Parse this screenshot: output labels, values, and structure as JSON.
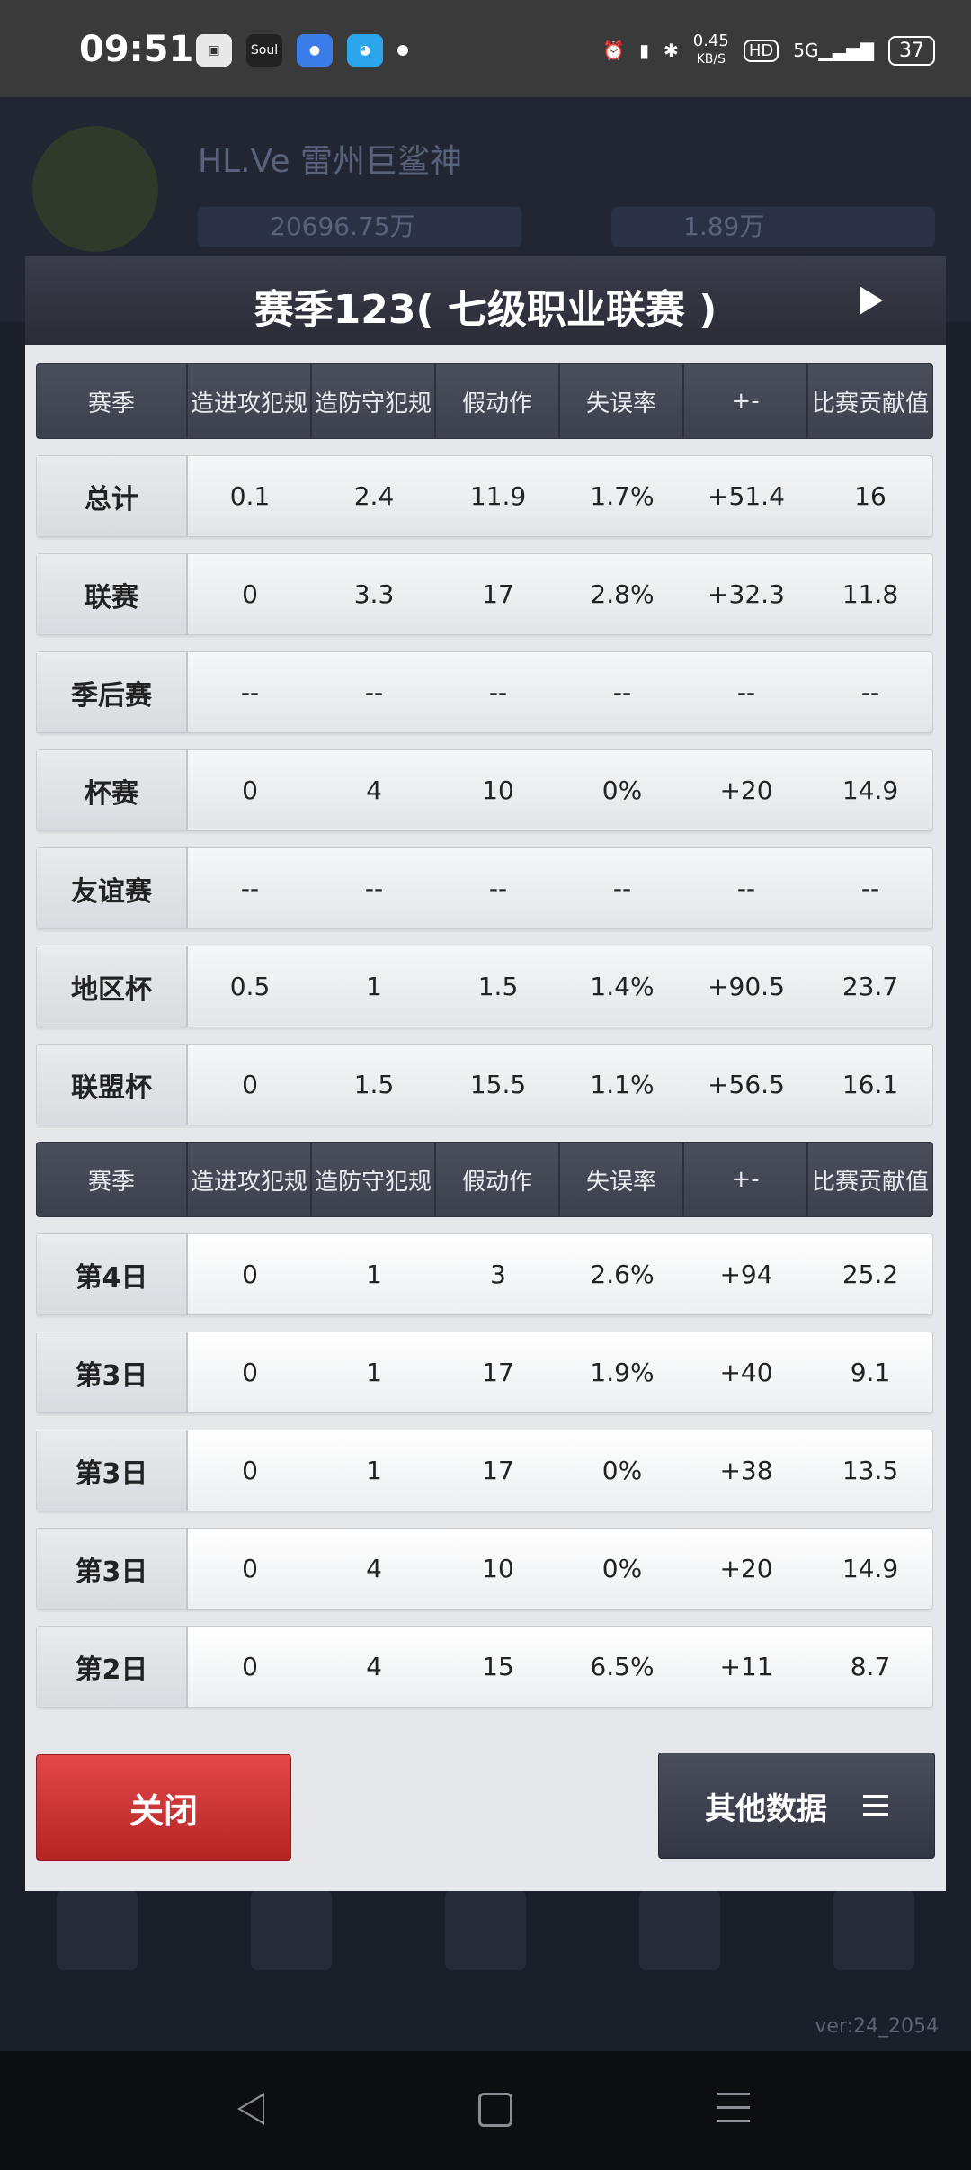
{
  "status": {
    "time": "09:51",
    "left_icons": [
      "tv-app-icon",
      "soul-app-icon",
      "baidu-app-icon",
      "qq-app-icon"
    ],
    "soul_label": "Soul",
    "speed": "0.45",
    "speed_unit": "KB/S",
    "hd": "HD",
    "network": "5G",
    "battery": "37"
  },
  "background": {
    "player_name": "HL.Ve 雷州巨鲨神",
    "stat1": "20696.75万",
    "stat2": "1.89万",
    "version": "ver:24_2054"
  },
  "dialog": {
    "title": "赛季123( 七级职业联赛 )"
  },
  "headers": [
    "赛季",
    "造进攻犯规",
    "造防守犯规",
    "假动作",
    "失误率",
    "+-",
    "比赛贡献值"
  ],
  "summary_rows": [
    {
      "label": "总计",
      "color": "#a9a9a9",
      "values": [
        "0.1",
        "2.4",
        "11.9",
        "1.7%",
        "+51.4",
        "16"
      ]
    },
    {
      "label": "联赛",
      "color": "#6fb0f5",
      "values": [
        "0",
        "3.3",
        "17",
        "2.8%",
        "+32.3",
        "11.8"
      ]
    },
    {
      "label": "季后赛",
      "color": "#f07a7a",
      "values": [
        "--",
        "--",
        "--",
        "--",
        "--",
        "--"
      ]
    },
    {
      "label": "杯赛",
      "color": "#7ec23a",
      "values": [
        "0",
        "4",
        "10",
        "0%",
        "+20",
        "14.9"
      ]
    },
    {
      "label": "友谊赛",
      "color": "#f5a84a",
      "values": [
        "--",
        "--",
        "--",
        "--",
        "--",
        "--"
      ]
    },
    {
      "label": "地区杯",
      "color": "#2fe0d0",
      "values": [
        "0.5",
        "1",
        "1.5",
        "1.4%",
        "+90.5",
        "23.7"
      ]
    },
    {
      "label": "联盟杯",
      "color": "#a87ad6",
      "values": [
        "0",
        "1.5",
        "15.5",
        "1.1%",
        "+56.5",
        "16.1"
      ]
    }
  ],
  "game_rows": [
    {
      "label": "第4日",
      "color": "#2fe0d0",
      "values": [
        "0",
        "1",
        "3",
        "2.6%",
        "+94",
        "25.2"
      ]
    },
    {
      "label": "第3日",
      "color": "#6fb0f5",
      "values": [
        "0",
        "1",
        "17",
        "1.9%",
        "+40",
        "9.1"
      ]
    },
    {
      "label": "第3日",
      "color": "#a87ad6",
      "values": [
        "0",
        "1",
        "17",
        "0%",
        "+38",
        "13.5"
      ]
    },
    {
      "label": "第3日",
      "color": "#7ec23a",
      "values": [
        "0",
        "4",
        "10",
        "0%",
        "+20",
        "14.9"
      ]
    },
    {
      "label": "第2日",
      "color": "#6fb0f5",
      "values": [
        "0",
        "4",
        "15",
        "6.5%",
        "+11",
        "8.7"
      ]
    },
    {
      "label": "",
      "color": "#a87ad6",
      "values": [
        "",
        "",
        "",
        "",
        "",
        ""
      ]
    }
  ],
  "buttons": {
    "close": "关闭",
    "other": "其他数据"
  }
}
